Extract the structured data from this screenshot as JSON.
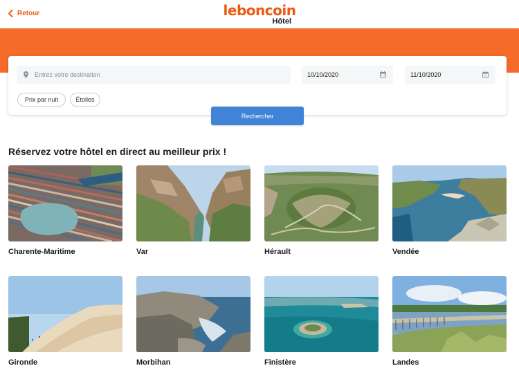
{
  "header": {
    "back_label": "Retour",
    "logo_text": "leboncoin",
    "logo_sub": "Hôtel"
  },
  "search": {
    "destination_placeholder": "Entrez votre destination",
    "checkin": "10/10/2020",
    "checkout": "11/10/2020",
    "filters": [
      "Prix par nuit",
      "Étoiles"
    ],
    "button_label": "Rechercher"
  },
  "main": {
    "heading": "Réservez votre hôtel en direct au meilleur prix !",
    "destinations": [
      {
        "label": "Charente-Maritime"
      },
      {
        "label": "Var"
      },
      {
        "label": "Hérault"
      },
      {
        "label": "Vendée"
      },
      {
        "label": "Gironde"
      },
      {
        "label": "Morbihan"
      },
      {
        "label": "Finistère"
      },
      {
        "label": "Landes"
      }
    ]
  },
  "colors": {
    "brand": "#ec5a13",
    "band": "#f56b2a",
    "button": "#4183d7"
  }
}
